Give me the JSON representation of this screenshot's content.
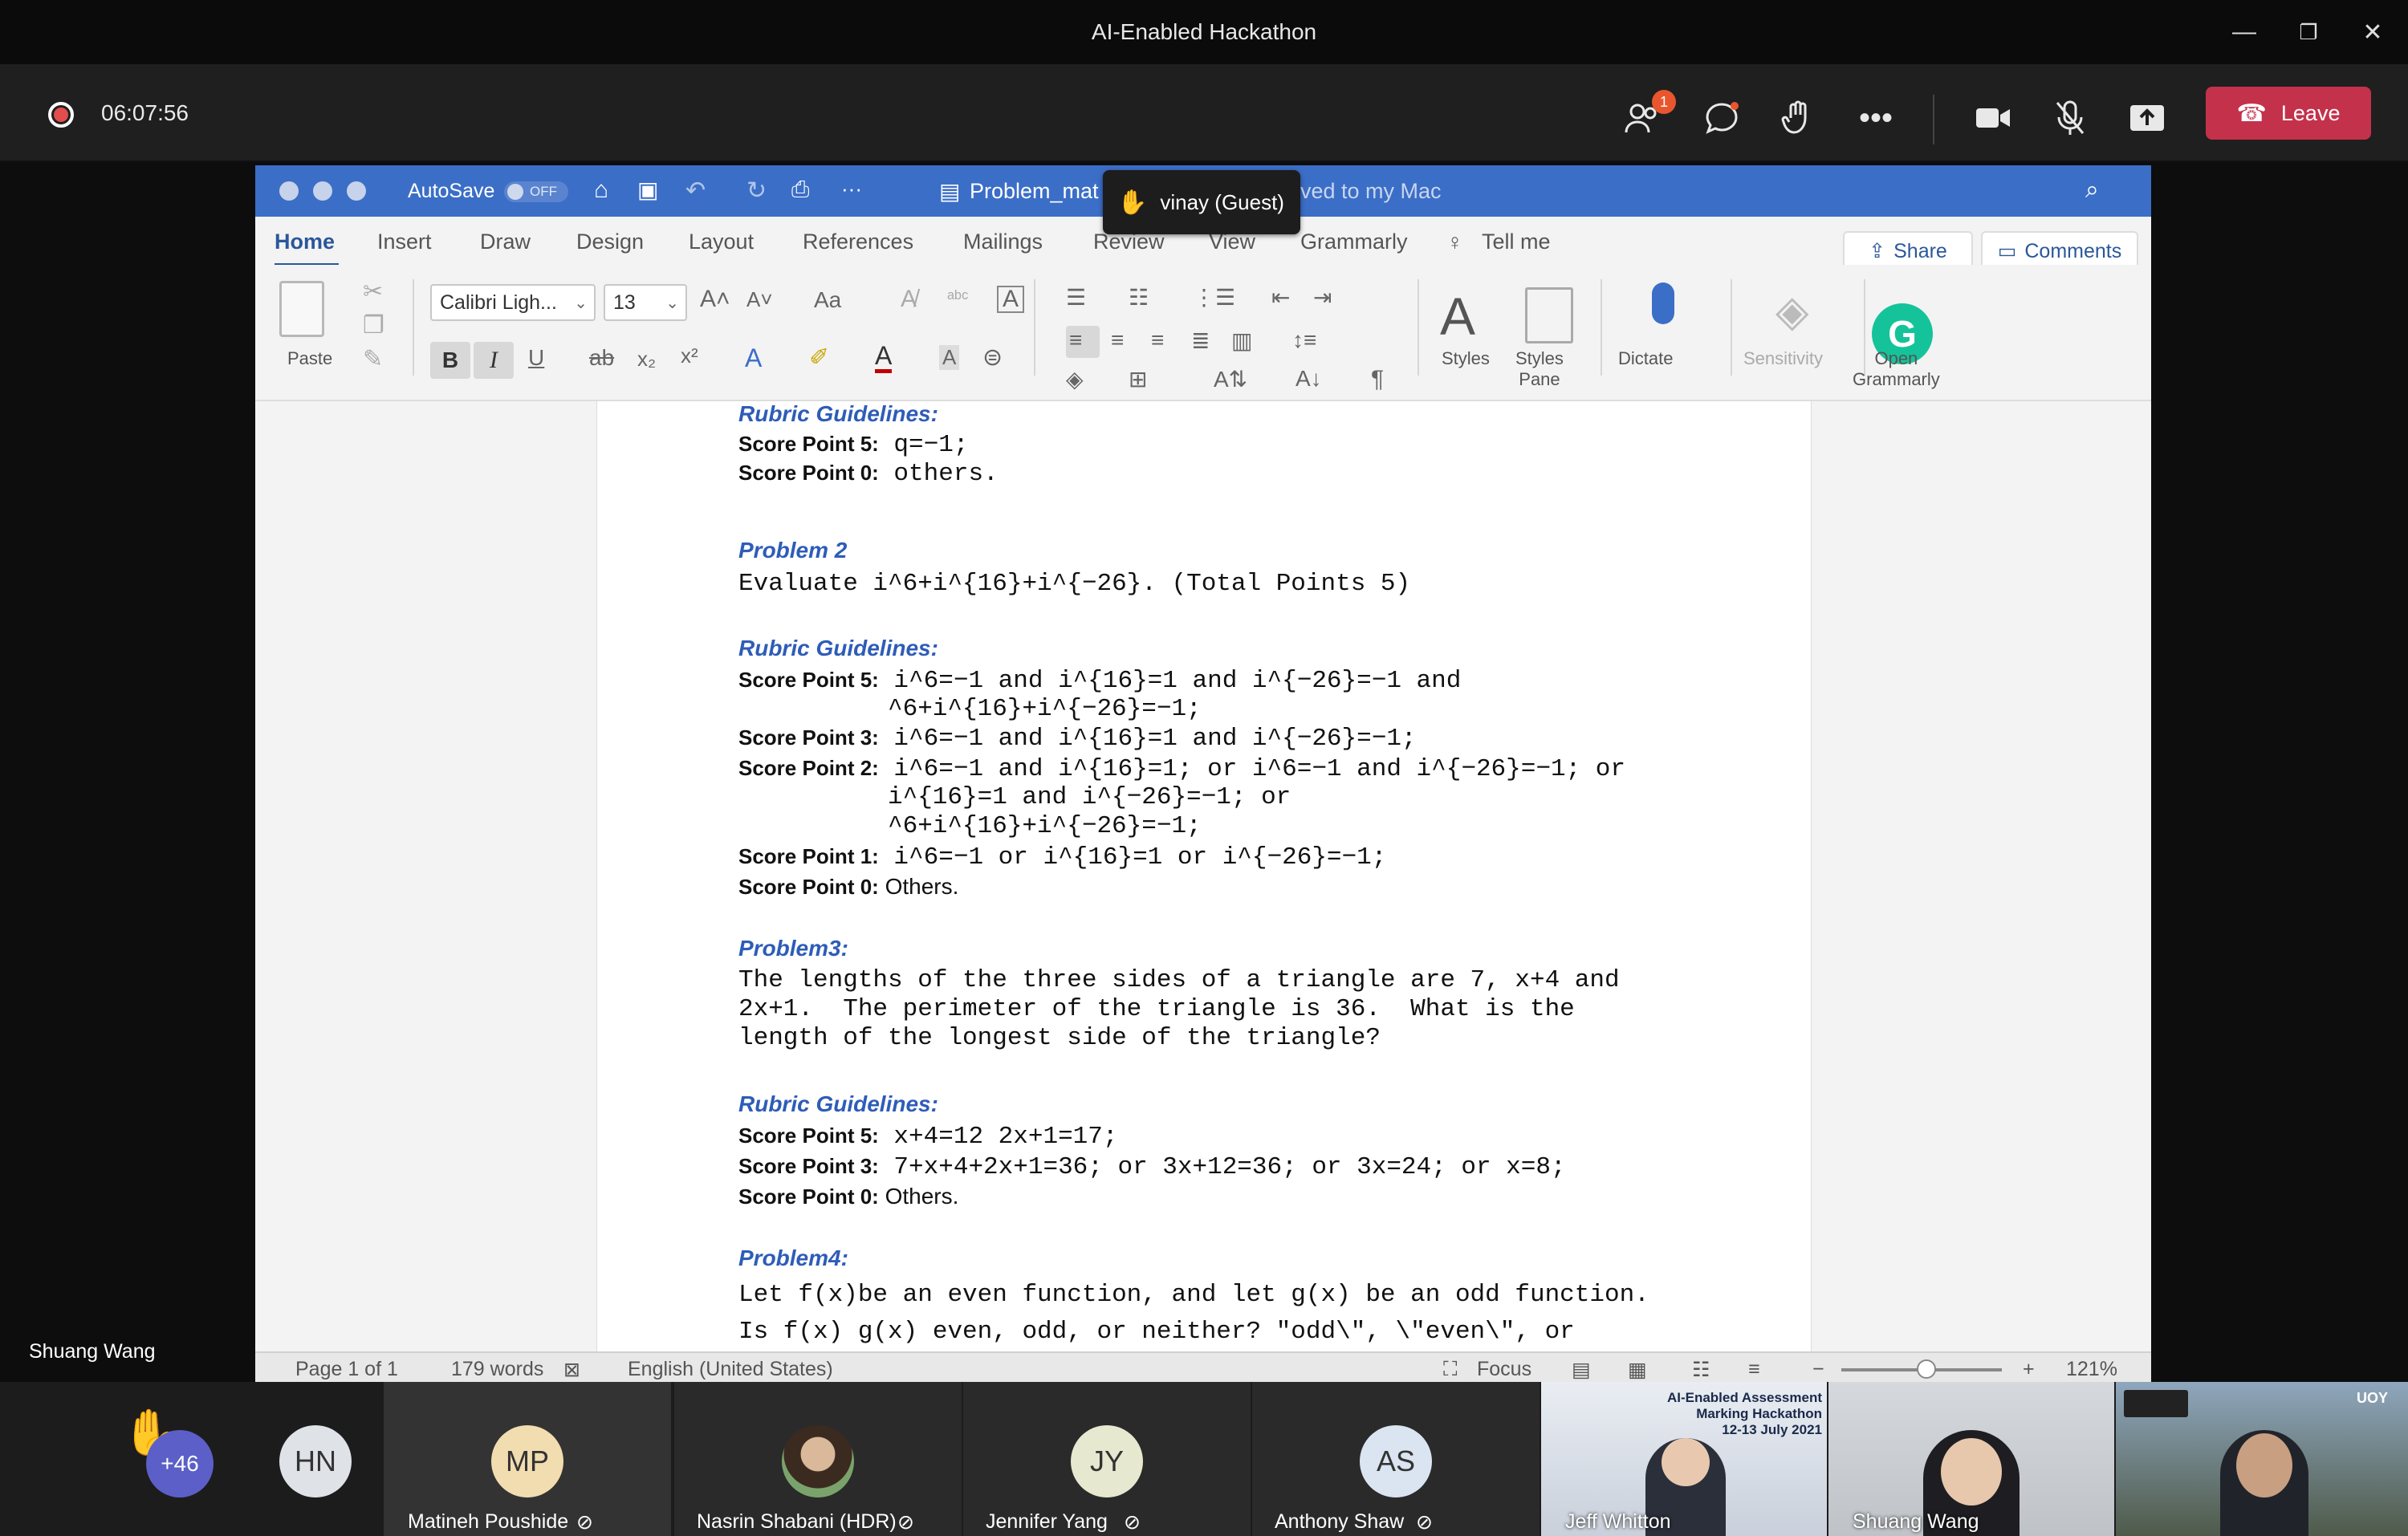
{
  "window": {
    "title": "AI-Enabled Hackathon",
    "minimize": "—",
    "restore": "❐",
    "close": "✕"
  },
  "meeting": {
    "timer": "06:07:56",
    "participants_badge": "1",
    "leave_label": "Leave"
  },
  "word": {
    "autosave_label": "AutoSave",
    "autosave_state": "OFF",
    "doc_title_left": "Problem_mat",
    "doc_title_right": "ved to my Mac",
    "guest_label": "vinay (Guest)",
    "tabs": [
      "Home",
      "Insert",
      "Draw",
      "Design",
      "Layout",
      "References",
      "Mailings",
      "Review",
      "View",
      "Grammarly"
    ],
    "tell_me": "Tell me",
    "share_label": "Share",
    "comments_label": "Comments",
    "ribbon": {
      "paste": "Paste",
      "font": "Calibri Ligh...",
      "size": "13",
      "styles": "Styles",
      "styles_pane": "Styles\nPane",
      "dictate": "Dictate",
      "sensitivity": "Sensitivity",
      "open_grammarly": "Open\nGrammarly"
    },
    "doc": {
      "rg1": "Rubric Guidelines:",
      "sp5a_label": "Score Point 5:",
      "sp5a_text": " q=−1;",
      "sp0a_label": "Score Point 0:",
      "sp0a_text": " others.",
      "p2_head": "Problem 2",
      "p2_text": "Evaluate i^6+i^{16}+i^{−26}. (Total Points 5)",
      "rg2": "Rubric Guidelines:",
      "sp5b_label": "Score Point 5:",
      "sp5b_text1": " i^6=−1 and i^{16}=1 and i^{−26}=−1 and",
      "sp5b_text2": "^6+i^{16}+i^{−26}=−1;",
      "sp3b_label": "Score Point 3:",
      "sp3b_text": " i^6=−1 and i^{16}=1 and i^{−26}=−1;",
      "sp2b_label": "Score Point 2:",
      "sp2b_text1": " i^6=−1 and i^{16}=1; or i^6=−1 and i^{−26}=−1; or",
      "sp2b_text2": "i^{16}=1 and i^{−26}=−1; or",
      "sp2b_text3": "^6+i^{16}+i^{−26}=−1;",
      "sp1b_label": "Score Point 1:",
      "sp1b_text": " i^6=−1 or i^{16}=1 or i^{−26}=−1;",
      "sp0b_label": "Score Point 0:",
      "sp0b_text": " Others.",
      "p3_head": "Problem3:",
      "p3_line1": "The lengths of the three sides of a triangle are 7, x+4 and",
      "p3_line2": "2x+1.  The perimeter of the triangle is 36.  What is the",
      "p3_line3": "length of the longest side of the triangle?",
      "rg3": "Rubric Guidelines:",
      "sp5c_label": "Score Point 5:",
      "sp5c_text": " x+4=12 2x+1=17;",
      "sp3c_label": "Score Point 3:",
      "sp3c_text": " 7+x+4+2x+1=36; or 3x+12=36; or 3x=24; or x=8;",
      "sp0c_label": "Score Point 0:",
      "sp0c_text": " Others.",
      "p4_head": "Problem4:",
      "p4_line1": "Let f(x)be an even function, and let g(x) be an odd function.",
      "p4_line2": "Is f(x) g(x) even, odd, or neither? \"odd\\\", \\\"even\\\", or"
    },
    "status": {
      "page": "Page 1 of 1",
      "words": "179 words",
      "language": "English (United States)",
      "focus": "Focus",
      "zoom": "121%"
    }
  },
  "presenter_name": "Shuang Wang",
  "roster": {
    "raised_count": "+46",
    "people": [
      {
        "initials": "HN",
        "name": ""
      },
      {
        "initials": "MP",
        "name": "Matineh Poushide"
      },
      {
        "initials": "",
        "name": "Nasrin Shabani (HDR)"
      },
      {
        "initials": "JY",
        "name": "Jennifer Yang"
      },
      {
        "initials": "AS",
        "name": "Anthony Shaw"
      }
    ],
    "video1_name": "Jeff Whitton",
    "video2_name": "Shuang Wang",
    "video1_banner": "AI-Enabled Assessment\nMarking Hackathon\n12-13 July 2021",
    "video3_tag": "UOY"
  }
}
